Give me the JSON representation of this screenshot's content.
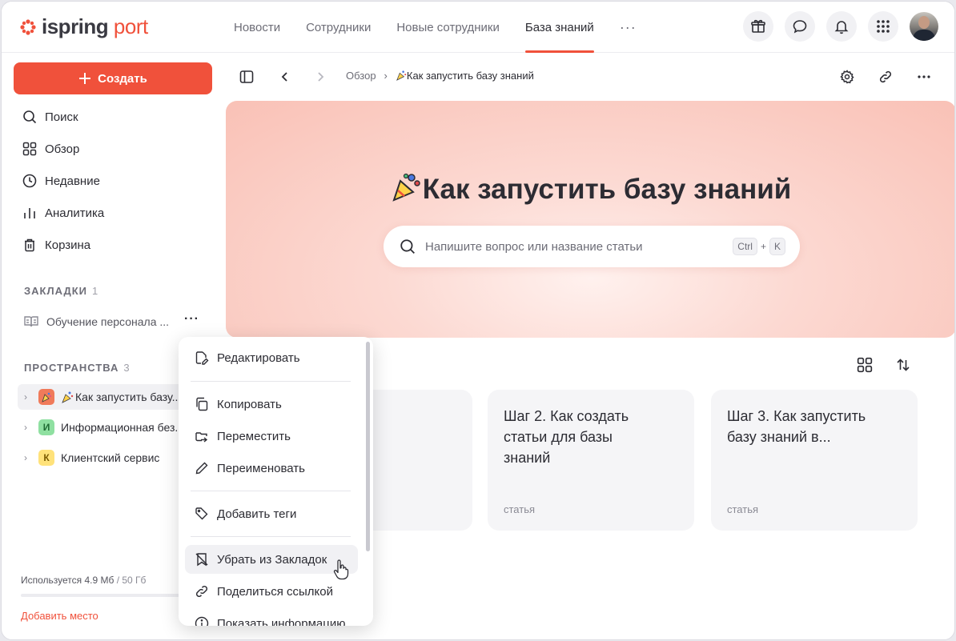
{
  "app": {
    "logo_main": "ispring",
    "logo_accent": "port",
    "brand_color": "#f0513b"
  },
  "nav": {
    "items": [
      "Новости",
      "Сотрудники",
      "Новые сотрудники",
      "База знаний"
    ],
    "active": "База знаний",
    "more": "···"
  },
  "top_icons": [
    "gift-icon",
    "chat-icon",
    "bell-icon",
    "apps-grid-icon",
    "user-avatar"
  ],
  "sidebar": {
    "create_label": "Создать",
    "menu": [
      "Поиск",
      "Обзор",
      "Недавние",
      "Аналитика",
      "Корзина"
    ],
    "bookmarks_title": "ЗАКЛАДКИ",
    "bookmarks_count": "1",
    "bookmark_item": "Обучение персонала ...",
    "bookmark_more": "···",
    "spaces_title": "ПРОСТРАНСТВА",
    "spaces_count": "3",
    "spaces": [
      {
        "label": "Как запустить базу...",
        "badge": "",
        "badge_icon": "party-popper-icon",
        "color": "#f07a5a"
      },
      {
        "label": "Информационная без...",
        "badge": "И",
        "color": "#8fe0a1"
      },
      {
        "label": "Клиентский сервис",
        "badge": "К",
        "color": "#ffe27a"
      }
    ],
    "usage_used": "Используется 4.9 Мб",
    "usage_max": " / 50 Гб",
    "add_space": "Добавить место"
  },
  "breadcrumb": {
    "root": "Обзор",
    "current": "Как запустить базу знаний"
  },
  "hero": {
    "title": "Как запустить базу знаний",
    "search_placeholder": "Напишите вопрос или название статьи",
    "kbd_ctrl": "Ctrl",
    "kbd_plus": "+",
    "kbd_k": "K"
  },
  "cards": [
    {
      "title": "Шаг 2. Как создать статьи для базы знаний",
      "type": "статья"
    },
    {
      "title": "Шаг 3. Как запустить базу знаний в...",
      "type": "статья"
    }
  ],
  "context_menu": {
    "items": [
      "Редактировать",
      "Копировать",
      "Переместить",
      "Переименовать",
      "Добавить теги",
      "Убрать из Закладок",
      "Поделиться ссылкой",
      "Показать информацию"
    ],
    "hovered": "Убрать из Закладок"
  }
}
